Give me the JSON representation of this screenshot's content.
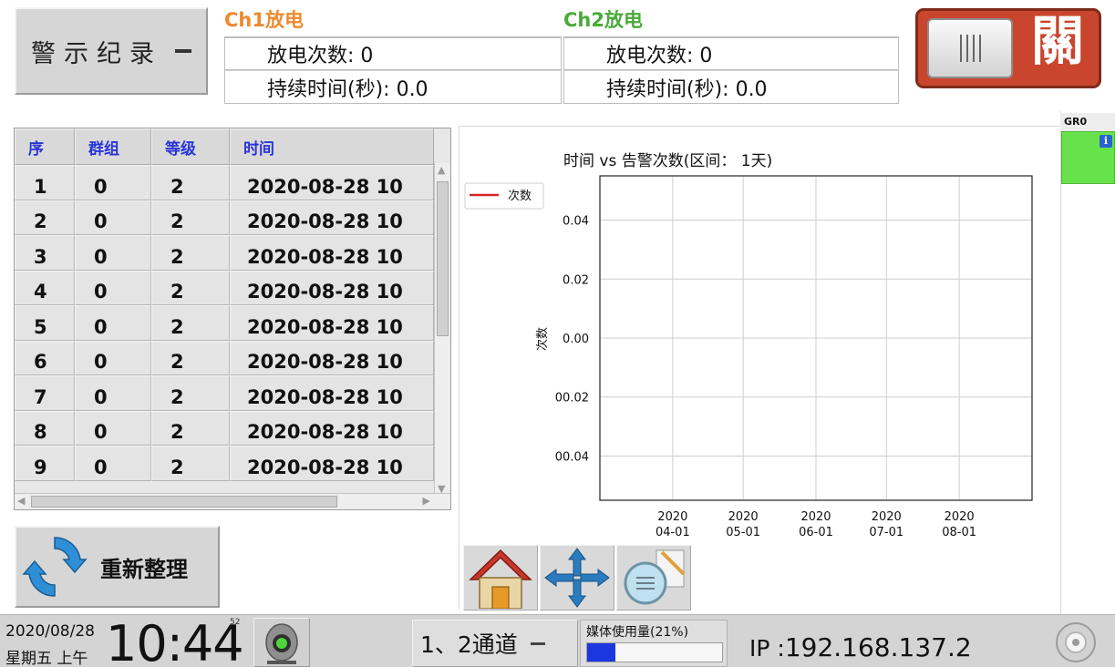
{
  "menu": {
    "label": "警示纪录"
  },
  "ch1": {
    "title": "Ch1放电",
    "count_label": "放电次数: 0",
    "duration_label": "持续时间(秒): 0.0"
  },
  "ch2": {
    "title": "Ch2放电",
    "count_label": "放电次数: 0",
    "duration_label": "持续时间(秒): 0.0"
  },
  "switch": {
    "glyph": "關"
  },
  "table": {
    "headers": [
      "序",
      "群组",
      "等级",
      "时间"
    ],
    "rows": [
      [
        "1",
        "0",
        "2",
        "2020-08-28 10"
      ],
      [
        "2",
        "0",
        "2",
        "2020-08-28 10"
      ],
      [
        "3",
        "0",
        "2",
        "2020-08-28 10"
      ],
      [
        "4",
        "0",
        "2",
        "2020-08-28 10"
      ],
      [
        "5",
        "0",
        "2",
        "2020-08-28 10"
      ],
      [
        "6",
        "0",
        "2",
        "2020-08-28 10"
      ],
      [
        "7",
        "0",
        "2",
        "2020-08-28 10"
      ],
      [
        "8",
        "0",
        "2",
        "2020-08-28 10"
      ],
      [
        "9",
        "0",
        "2",
        "2020-08-28 10"
      ]
    ]
  },
  "chart_data": {
    "type": "line",
    "title": "时间 vs 告警次数(区间： 1天)",
    "ylabel": "次数",
    "xlabel": "",
    "legend": {
      "placement": "top-left",
      "entries": [
        {
          "name": "次数",
          "color": "#d62728"
        }
      ]
    },
    "x_ticks": [
      [
        "2020",
        "04-01"
      ],
      [
        "2020",
        "05-01"
      ],
      [
        "2020",
        "06-01"
      ],
      [
        "2020",
        "07-01"
      ],
      [
        "2020",
        "08-01"
      ]
    ],
    "x_tick_dates": [
      "2020-04-01",
      "2020-05-01",
      "2020-06-01",
      "2020-07-01",
      "2020-08-01"
    ],
    "y_ticks": [
      "0.04",
      "0.02",
      "0.00",
      "00.02",
      "00.04"
    ],
    "y_tick_values": [
      0.04,
      0.02,
      0.0,
      -0.02,
      -0.04
    ],
    "ylim": [
      -0.055,
      0.055
    ],
    "xlim": [
      "2020-03-01",
      "2020-09-01"
    ],
    "grid": true,
    "series": [
      {
        "name": "次数",
        "values": []
      }
    ]
  },
  "toolbar": {
    "icons": [
      "home-icon",
      "move-icon",
      "zoom-icon"
    ]
  },
  "refresh": {
    "label": "重新整理"
  },
  "side": {
    "header": "GR0",
    "info": "i"
  },
  "status": {
    "date": "2020/08/28",
    "weekday": "星期五 上午",
    "clock": "10:44",
    "rs": "52",
    "channel": "1、2通道",
    "media_label": "媒体使用量(21%)",
    "media_percent": 21,
    "ip_prefix": "IP :",
    "ip": "192.168.137.2"
  },
  "colors": {
    "ch1": "#ef8a2e",
    "ch2": "#4aaa3a",
    "switch": "#c9452d",
    "header_text": "#2a35d8",
    "status_green": "#66e34a",
    "media_fill": "#1d37e0"
  }
}
